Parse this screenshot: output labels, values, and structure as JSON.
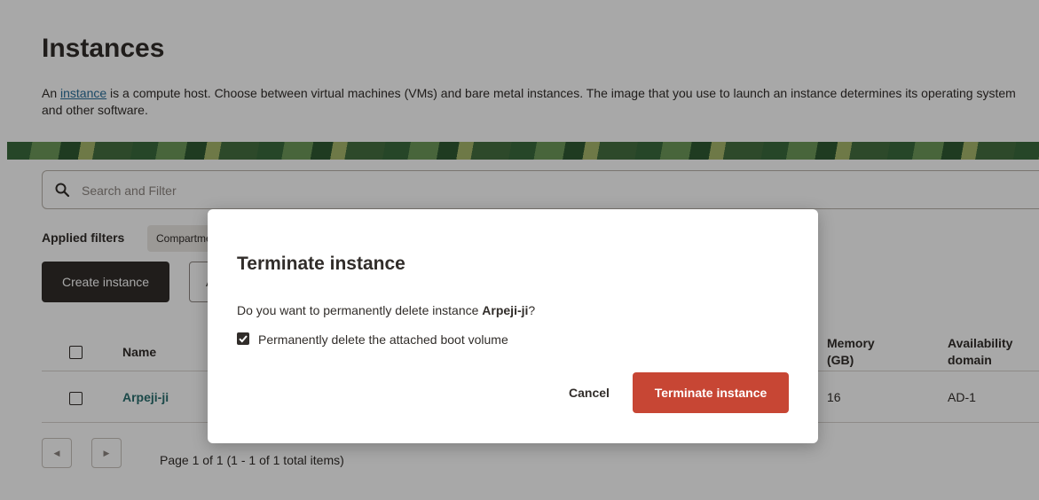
{
  "page": {
    "title": "Instances",
    "description_prefix": "An ",
    "description_link": "instance",
    "description_suffix": " is a compute host. Choose between virtual machines (VMs) and bare metal instances. The image that you use to launch an instance determines its operating system and other software."
  },
  "search": {
    "placeholder": "Search and Filter",
    "value": ""
  },
  "filters": {
    "label": "Applied filters",
    "chip": "Compartment"
  },
  "toolbar": {
    "create_label": "Create instance",
    "actions_label": "Actions"
  },
  "table": {
    "headers": {
      "name": "Name",
      "memory": "Memory (GB)",
      "availability": "Availability domain"
    },
    "rows": [
      {
        "name": "Arpeji-ji",
        "memory": "16",
        "availability": "AD-1"
      }
    ]
  },
  "pagination": {
    "text": "Page 1 of 1 (1 - 1 of 1 total items)",
    "prev_icon": "◀",
    "next_icon": "▶"
  },
  "modal": {
    "title": "Terminate instance",
    "question_prefix": "Do you want to permanently delete instance ",
    "instance_name": "Arpeji-ji",
    "question_suffix": "?",
    "checkbox_label": "Permanently delete the attached boot volume",
    "checkbox_checked": true,
    "cancel_label": "Cancel",
    "terminate_label": "Terminate instance"
  },
  "colors": {
    "danger": "#c74634",
    "primary_dark": "#312d2a",
    "link": "#2a6f9c"
  }
}
